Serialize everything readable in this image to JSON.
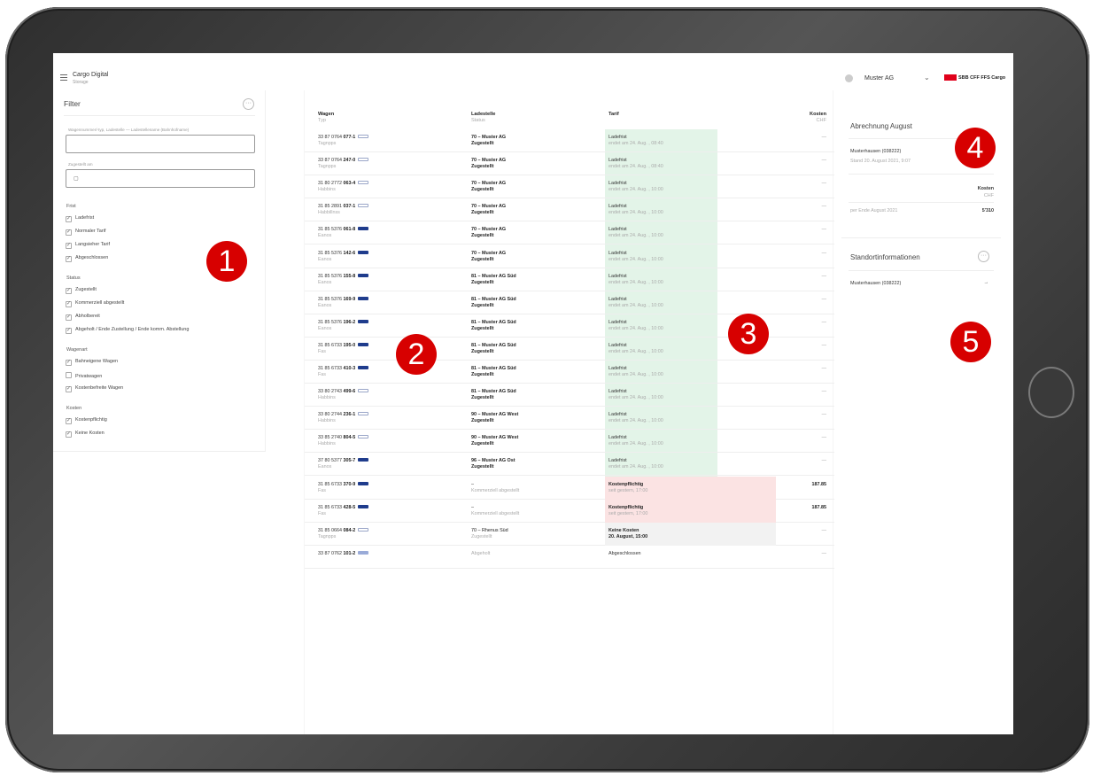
{
  "app": {
    "title": "Cargo Digital",
    "subtitle": "Storage"
  },
  "user": {
    "company": "Muster AG",
    "brand": "SBB CFF FFS Cargo"
  },
  "filter": {
    "title": "Filter",
    "search_label": "Wagennummer/-typ, Ladestelle — Ladestellename (Bahnhofname)",
    "date_label": "Zugestellt am",
    "date_value": "",
    "groups": [
      {
        "label": "Frist",
        "items": [
          {
            "label": "Ladefrist",
            "checked": true
          },
          {
            "label": "Normaler Tarif",
            "checked": true
          },
          {
            "label": "Langsieher Tarif",
            "checked": true
          },
          {
            "label": "Abgeschlossen",
            "checked": true
          }
        ]
      },
      {
        "label": "Status",
        "items": [
          {
            "label": "Zugestellt",
            "checked": true
          },
          {
            "label": "Kommerziell abgestellt",
            "checked": true
          },
          {
            "label": "Abholbereit",
            "checked": true
          },
          {
            "label": "Abgeholt / Ende Zustellung / Ende komm. Abstellung",
            "checked": true
          }
        ]
      },
      {
        "label": "Wagenart",
        "items": [
          {
            "label": "Bahneigene Wagen",
            "checked": true
          },
          {
            "label": "Privatwagen",
            "checked": false
          },
          {
            "label": "Kostenbefreite Wagen",
            "checked": true
          }
        ]
      },
      {
        "label": "Kosten",
        "items": [
          {
            "label": "Kostenpflichtig",
            "checked": true
          },
          {
            "label": "Keine Kosten",
            "checked": true
          }
        ]
      }
    ]
  },
  "table": {
    "headers": {
      "wagen": "Wagen",
      "wagen_sub": "Typ",
      "ladestelle": "Ladestelle",
      "ladestelle_sub": "Status",
      "tarif": "Tarif",
      "kosten": "Kosten",
      "kosten_sub": "CHF"
    },
    "rows": [
      {
        "prefix": "33 87 0764",
        "num": "077-1",
        "typ": "Tagnpps",
        "icon": "hollow",
        "ladestelle": "70 – Muster AG",
        "status": "Zugestellt",
        "tarif": "Ladefrist",
        "tarif_sub": "endet am 24. Aug. , 08:40",
        "kosten": "—",
        "style": "green"
      },
      {
        "prefix": "33 87 0764",
        "num": "247-0",
        "typ": "Tagnpps",
        "icon": "hollow",
        "ladestelle": "70 – Muster AG",
        "status": "Zugestellt",
        "tarif": "Ladefrist",
        "tarif_sub": "endet am 24. Aug. , 08:40",
        "kosten": "—",
        "style": "green"
      },
      {
        "prefix": "31 80 2772",
        "num": "063-4",
        "typ": "Habbins",
        "icon": "hollow",
        "ladestelle": "70 – Muster AG",
        "status": "Zugestellt",
        "tarif": "Ladefrist",
        "tarif_sub": "endet am 24. Aug. , 10:00",
        "kosten": "—",
        "style": "green"
      },
      {
        "prefix": "31 85 2891",
        "num": "037-1",
        "typ": "Habbillnss",
        "icon": "hollow",
        "ladestelle": "70 – Muster AG",
        "status": "Zugestellt",
        "tarif": "Ladefrist",
        "tarif_sub": "endet am 24. Aug. , 10:00",
        "kosten": "—",
        "style": "green"
      },
      {
        "prefix": "31 85 5376",
        "num": "061-8",
        "typ": "Eanos",
        "icon": "filled",
        "ladestelle": "70 – Muster AG",
        "status": "Zugestellt",
        "tarif": "Ladefrist",
        "tarif_sub": "endet am 24. Aug. , 10:00",
        "kosten": "—",
        "style": "green"
      },
      {
        "prefix": "31 85 5376",
        "num": "142-6",
        "typ": "Eanos",
        "icon": "filled",
        "ladestelle": "70 – Muster AG",
        "status": "Zugestellt",
        "tarif": "Ladefrist",
        "tarif_sub": "endet am 24. Aug. , 10:00",
        "kosten": "—",
        "style": "green"
      },
      {
        "prefix": "31 85 5376",
        "num": "155-8",
        "typ": "Eanos",
        "icon": "filled",
        "ladestelle": "81 – Muster AG Süd",
        "status": "Zugestellt",
        "tarif": "Ladefrist",
        "tarif_sub": "endet am 24. Aug. , 10:00",
        "kosten": "—",
        "style": "green"
      },
      {
        "prefix": "31 85 5376",
        "num": "169-9",
        "typ": "Eanos",
        "icon": "filled",
        "ladestelle": "81 – Muster AG Süd",
        "status": "Zugestellt",
        "tarif": "Ladefrist",
        "tarif_sub": "endet am 24. Aug. , 10:00",
        "kosten": "—",
        "style": "green"
      },
      {
        "prefix": "31 85 5376",
        "num": "196-2",
        "typ": "Eanos",
        "icon": "filled",
        "ladestelle": "81 – Muster AG Süd",
        "status": "Zugestellt",
        "tarif": "Ladefrist",
        "tarif_sub": "endet am 24. Aug. , 10:00",
        "kosten": "—",
        "style": "green"
      },
      {
        "prefix": "31 85 6733",
        "num": "195-0",
        "typ": "Fas",
        "icon": "filled",
        "ladestelle": "81 – Muster AG Süd",
        "status": "Zugestellt",
        "tarif": "Ladefrist",
        "tarif_sub": "endet am 24. Aug. , 10:00",
        "kosten": "—",
        "style": "green"
      },
      {
        "prefix": "31 85 6733",
        "num": "410-3",
        "typ": "Fas",
        "icon": "filled",
        "ladestelle": "81 – Muster AG Süd",
        "status": "Zugestellt",
        "tarif": "Ladefrist",
        "tarif_sub": "endet am 24. Aug. , 10:00",
        "kosten": "—",
        "style": "green"
      },
      {
        "prefix": "33 80 2743",
        "num": "499-6",
        "typ": "Habbins",
        "icon": "hollow",
        "ladestelle": "81 – Muster AG Süd",
        "status": "Zugestellt",
        "tarif": "Ladefrist",
        "tarif_sub": "endet am 24. Aug. , 10:00",
        "kosten": "—",
        "style": "green"
      },
      {
        "prefix": "33 80 2744",
        "num": "236-1",
        "typ": "Habbins",
        "icon": "hollow",
        "ladestelle": "90 – Muster AG West",
        "status": "Zugestellt",
        "tarif": "Ladefrist",
        "tarif_sub": "endet am 24. Aug. , 10:00",
        "kosten": "—",
        "style": "green"
      },
      {
        "prefix": "33 85 2740",
        "num": "804-5",
        "typ": "Habbins",
        "icon": "hollow",
        "ladestelle": "90 – Muster AG West",
        "status": "Zugestellt",
        "tarif": "Ladefrist",
        "tarif_sub": "endet am 24. Aug. , 10:00",
        "kosten": "—",
        "style": "green"
      },
      {
        "prefix": "37 80 5377",
        "num": "305-7",
        "typ": "Eanos",
        "icon": "filled",
        "ladestelle": "96 – Muster AG Ost",
        "status": "Zugestellt",
        "tarif": "Ladefrist",
        "tarif_sub": "endet am 24. Aug. , 10:00",
        "kosten": "—",
        "style": "green"
      },
      {
        "prefix": "31 85 6733",
        "num": "370-9",
        "typ": "Fas",
        "icon": "filled",
        "ladestelle": "–",
        "status": "Kommerziell abgestellt",
        "tarif": "Kostenpflichtig",
        "tarif_sub": "seit gestern, 17:00",
        "kosten": "187.85",
        "style": "pink"
      },
      {
        "prefix": "31 85 6733",
        "num": "428-5",
        "typ": "Fas",
        "icon": "filled",
        "ladestelle": "–",
        "status": "Kommerziell abgestellt",
        "tarif": "Kostenpflichtig",
        "tarif_sub": "seit gestern, 17:00",
        "kosten": "187.85",
        "style": "pink"
      },
      {
        "prefix": "31 85 0664",
        "num": "084-2",
        "typ": "Tagnpps",
        "icon": "hollow",
        "ladestelle": "70 – Rhenus Süd",
        "status": "Zugestellt",
        "tarif": "Keine Kosten",
        "tarif_sub": "20. August, 15:00",
        "kosten": "—",
        "style": "grey"
      },
      {
        "prefix": "33 87 0762",
        "num": "101-2",
        "typ": "",
        "icon": "light",
        "ladestelle": "Abgeholt",
        "status": "",
        "tarif": "Abgeschlossen",
        "tarif_sub": "",
        "kosten": "—",
        "style": "white"
      }
    ]
  },
  "abrechnung": {
    "title": "Abrechnung August",
    "location": "Musterhausen (038222)",
    "stand": "Stand 20. August 2021, 9:07",
    "kosten_label": "Kosten",
    "kosten_unit": "CHF",
    "period_label": "per Ende August 2021",
    "period_value": "5'310"
  },
  "standort": {
    "title": "Standortinformationen",
    "location": "Musterhausen (038222)",
    "arrow": "→"
  },
  "badges": [
    "1",
    "2",
    "3",
    "4",
    "5"
  ]
}
